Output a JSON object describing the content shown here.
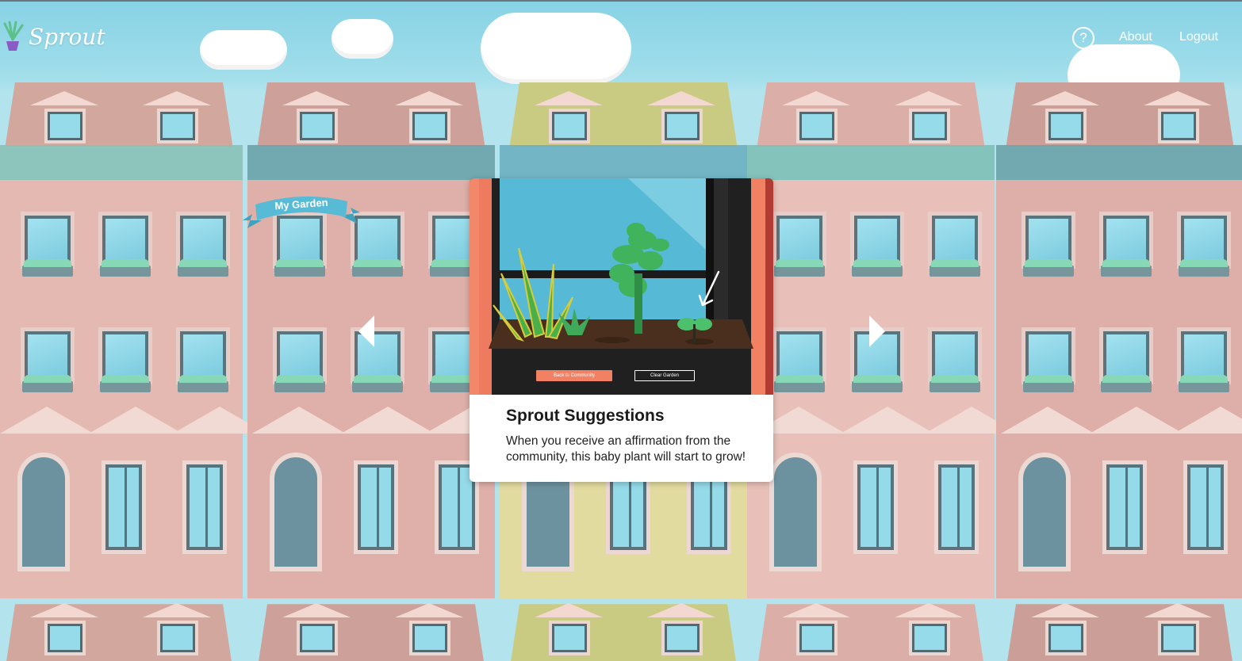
{
  "app": {
    "title": "Sprout"
  },
  "header": {
    "help_label": "?",
    "nav": [
      {
        "label": "About"
      },
      {
        "label": "Logout"
      }
    ]
  },
  "garden": {
    "ribbon_label": "My Garden"
  },
  "card": {
    "title": "Sprout Suggestions",
    "text": "When you receive an affirmation from the community, this baby plant will start to grow!",
    "scene_buttons": {
      "back_label": "Back to Community",
      "clear_label": "Clear Garden"
    }
  },
  "colors": {
    "sky": "#6cc9df",
    "accent": "#f28062",
    "brick_pink": "#d9a7a0",
    "brick_yellow": "#d6d27e",
    "cornice_teal": "#5aa5a0"
  },
  "icons": {
    "logo": "potted-plant-icon",
    "help": "question-circle-icon",
    "prev": "chevron-left-icon",
    "next": "chevron-right-icon"
  }
}
